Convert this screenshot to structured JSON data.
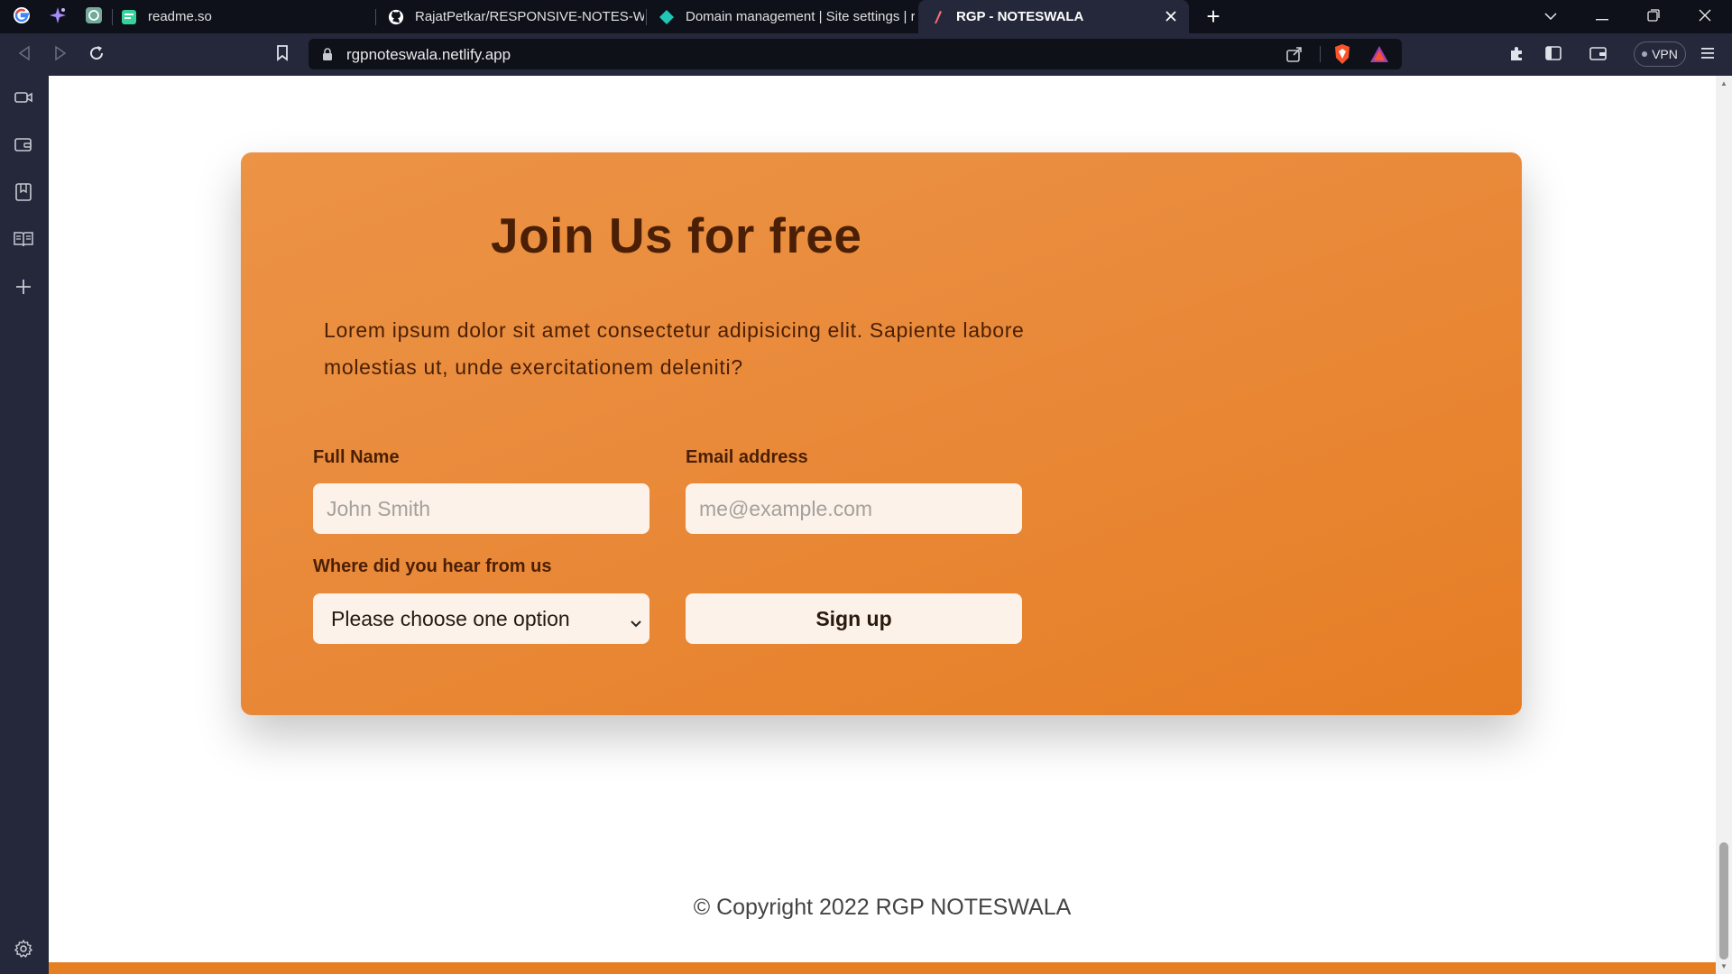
{
  "browser": {
    "tabs": [
      {
        "label": "readme.so",
        "active": false
      },
      {
        "label": "RajatPetkar/RESPONSIVE-NOTES-WEB",
        "active": false
      },
      {
        "label": "Domain management | Site settings | r",
        "active": false
      },
      {
        "label": "RGP - NOTESWALA",
        "active": true
      }
    ],
    "new_tab_label": "+",
    "url": "rgpnoteswala.netlify.app",
    "vpn_label": "VPN"
  },
  "page": {
    "card": {
      "title": "Join Us for free",
      "description": "Lorem ipsum dolor sit amet consectetur adipisicing elit. Sapiente labore molestias ut, unde exercitationem deleniti?",
      "full_name_label": "Full Name",
      "full_name_placeholder": "John Smith",
      "email_label": "Email address",
      "email_placeholder": "me@example.com",
      "source_label": "Where did you hear from us",
      "source_selected": "Please choose one option",
      "signup_label": "Sign up"
    },
    "footer": {
      "copyright": "© Copyright 2022 RGP NOTESWALA"
    }
  },
  "colors": {
    "accent": "#e67e22",
    "card_text": "#4a1f05",
    "input_bg": "#fdf2e9"
  },
  "icons": [
    "google-icon",
    "leo-icon",
    "chatgpt-icon",
    "readme-icon",
    "github-icon",
    "netlify-icon",
    "rgp-favicon",
    "close-icon",
    "chevron-down-icon",
    "minimize-icon",
    "restore-icon",
    "close-window-icon",
    "back-icon",
    "forward-icon",
    "reload-icon",
    "bookmark-icon",
    "lock-icon",
    "share-icon",
    "brave-shields-icon",
    "brave-rewards-icon",
    "extensions-icon",
    "sidebar-icon",
    "wallet-icon",
    "menu-icon",
    "video-icon",
    "bookmarks-icon",
    "reading-list-icon",
    "add-icon",
    "settings-icon"
  ]
}
